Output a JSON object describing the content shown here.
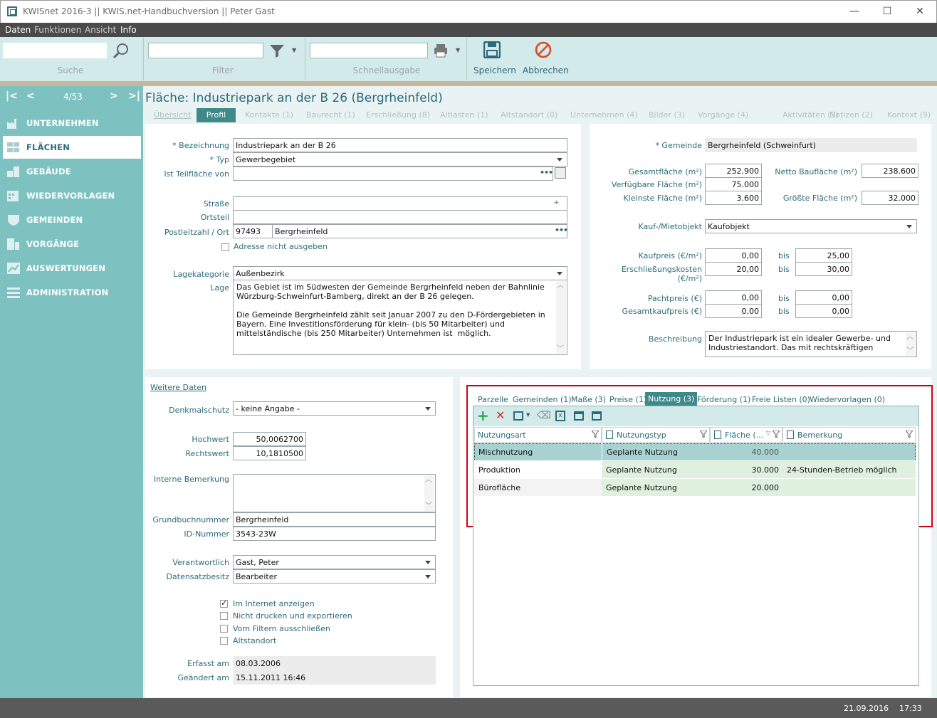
{
  "window": {
    "title": "KWISnet 2016-3 || KWIS.net-Handbuchversion || Peter Gast"
  },
  "menu": [
    "Daten",
    "Funktionen",
    "Ansicht",
    "Info"
  ],
  "toolbar": {
    "search_label": "Suche",
    "filter_label": "Filter",
    "quick_output_label": "Schnellausgabe",
    "save_label": "Speichern",
    "cancel_label": "Abbrechen"
  },
  "nav": {
    "position": "4/53"
  },
  "sidebar": {
    "items": [
      {
        "label": "UNTERNEHMEN",
        "icon": "factory-icon"
      },
      {
        "label": "FLÄCHEN",
        "icon": "area-icon"
      },
      {
        "label": "GEBÄUDE",
        "icon": "building-icon"
      },
      {
        "label": "WIEDERVORLAGEN",
        "icon": "calendar-icon"
      },
      {
        "label": "GEMEINDEN",
        "icon": "shield-icon"
      },
      {
        "label": "VORGÄNGE",
        "icon": "process-icon"
      },
      {
        "label": "AUSWERTUNGEN",
        "icon": "chart-icon"
      },
      {
        "label": "ADMINISTRATION",
        "icon": "admin-icon"
      }
    ]
  },
  "page": {
    "title": "Fläche: Industriepark an der B 26 (Bergrheinfeld)",
    "tabs": [
      "Übersicht",
      "Profil",
      "Kontakte (1)",
      "Baurecht (1)",
      "Erschließung (8)",
      "Altlasten (1)",
      "Altstandort (0)",
      "Unternehmen (4)",
      "Bilder (3)",
      "Vorgänge (4)",
      "Aktivitäten (3)",
      "Notizen (2)",
      "Kontext (9)"
    ]
  },
  "form_left": {
    "bezeichnung_label": "* Bezeichnung",
    "bezeichnung": "Industriepark an der B 26",
    "typ_label": "* Typ",
    "typ": "Gewerbegebiet",
    "teilflaeche_label": "Ist Teilfläche von",
    "teilflaeche": "",
    "strasse_label": "Straße",
    "strasse": "",
    "ortsteil_label": "Ortsteil",
    "ortsteil": "",
    "plz_label": "Postleitzahl / Ort",
    "plz": "97493",
    "ort": "Bergrheinfeld",
    "adresse_label": "Adresse nicht ausgeben",
    "lagekategorie_label": "Lagekategorie",
    "lagekategorie": "Außenbezirk",
    "lage_label": "Lage",
    "lage": "Das Gebiet ist im Südwesten der Gemeinde Bergrheinfeld neben der Bahnlinie Würzburg-Schweinfurt-Bamberg, direkt an der B 26 gelegen.\n\nDie Gemeinde Bergrheinfeld zählt seit Januar 2007 zu den D-Fördergebieten in Bayern. Eine Investitionsförderung für klein- (bis 50 Mitarbeiter) und mittelständische (bis 250 Mitarbeiter) Unternehmen ist  möglich."
  },
  "form_right": {
    "gemeinde_label": "* Gemeinde",
    "gemeinde": "Bergrheinfeld (Schweinfurt)",
    "gesamtflaeche_label": "Gesamtfläche (m²)",
    "gesamtflaeche": "252.900",
    "netto_label": "Netto Baufläche (m²)",
    "netto": "238.600",
    "verfuegbar_label": "Verfügbare Fläche (m²)",
    "verfuegbar": "75.000",
    "kleinste_label": "Kleinste Fläche (m²)",
    "kleinste": "3.600",
    "groesste_label": "Größte Fläche (m²)",
    "groesste": "32.000",
    "kauf_label": "Kauf-/Mietobjekt",
    "kauf": "Kaufobjekt",
    "kaufpreis_label": "Kaufpreis (€/m²)",
    "kaufpreis_von": "0,00",
    "kaufpreis_bis": "25,00",
    "erschl_label": "Erschließungskosten (€/m²)",
    "erschl_von": "20,00",
    "erschl_bis": "30,00",
    "pacht_label": "Pachtpreis (€)",
    "pacht_von": "0,00",
    "pacht_bis": "0,00",
    "gesamtkauf_label": "Gesamtkaufpreis (€)",
    "gesamtkauf_von": "0,00",
    "gesamtkauf_bis": "0,00",
    "bis": "bis",
    "beschreibung_label": "Beschreibung",
    "beschreibung": "Der Industriepark ist ein idealer Gewerbe- und Industriestandort. Das mit rechtskräftigen"
  },
  "weitere": {
    "link": "Weitere Daten",
    "denkmal_label": "Denkmalschutz",
    "denkmal": "- keine Angabe -",
    "hochwert_label": "Hochwert",
    "hochwert": "50,0062700",
    "rechtswert_label": "Rechtswert",
    "rechtswert": "10,1810500",
    "interne_label": "Interne Bemerkung",
    "interne": "",
    "grundbuch_label": "Grundbuchnummer",
    "grundbuch": "Bergrheinfeld",
    "id_label": "ID-Nummer",
    "id": "3543-23W",
    "verantwortlich_label": "Verantwortlich",
    "verantwortlich": "Gast, Peter",
    "besitz_label": "Datensatzbesitz",
    "besitz": "Bearbeiter",
    "checks": [
      {
        "label": "Im Internet anzeigen",
        "checked": true
      },
      {
        "label": "Nicht drucken und exportieren",
        "checked": false
      },
      {
        "label": "Vom Filtern ausschließen",
        "checked": false
      },
      {
        "label": "Altstandort",
        "checked": false
      }
    ],
    "erfasst_label": "Erfasst am",
    "erfasst": "08.03.2006",
    "geaendert_label": "Geändert am",
    "geaendert": "15.11.2011 16:46"
  },
  "subpanel": {
    "tabs": [
      "Parzelle",
      "Gemeinden (1)",
      "Maße (3)",
      "Preise (1)",
      "Nutzung (3)",
      "Förderung (1)",
      "Freie Listen (0)",
      "Wiedervorlagen (0)"
    ],
    "active_tab": "Nutzung (3)",
    "columns": [
      "Nutzungsart",
      "Nutzungstyp",
      "Fläche (...",
      "Bemerkung"
    ],
    "rows": [
      [
        "Mischnutzung",
        "Geplante Nutzung",
        "40.000",
        ""
      ],
      [
        "Produktion",
        "Geplante Nutzung",
        "30.000",
        "24-Stunden-Betrieb möglich"
      ],
      [
        "Bürofläche",
        "Geplante Nutzung",
        "20.000",
        ""
      ]
    ]
  },
  "status": {
    "date": "21.09.2016",
    "time": "17:33"
  },
  "colors": {
    "accent": "#3f8a89",
    "sidebar": "#7dc2c0",
    "highlight_border": "#d0021b"
  }
}
